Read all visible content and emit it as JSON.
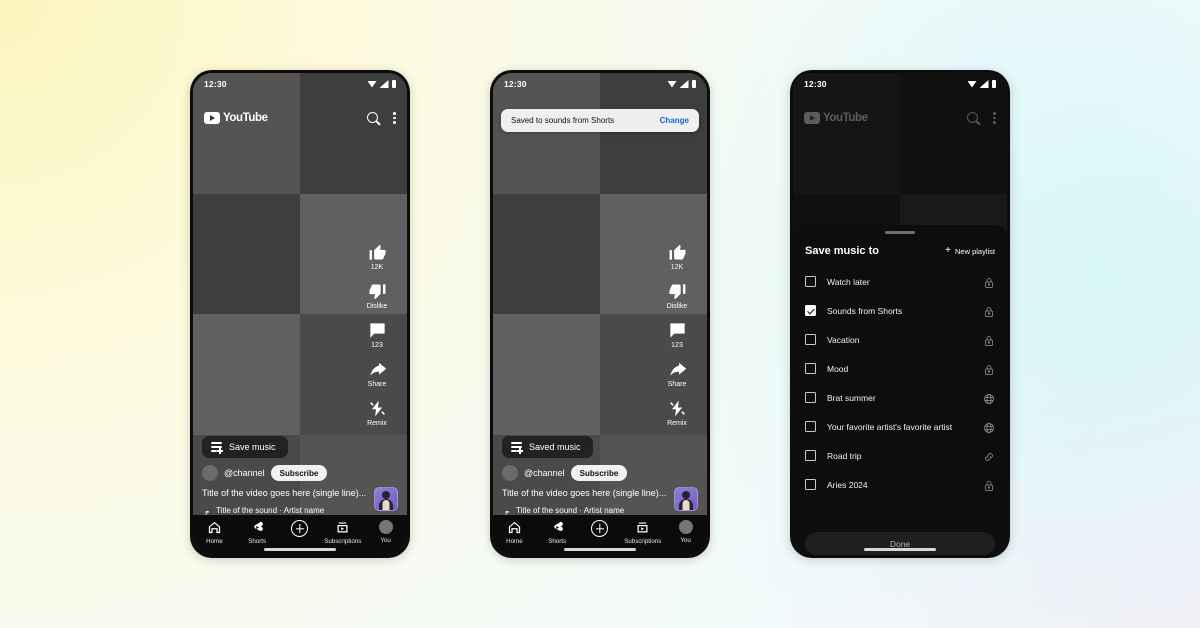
{
  "background": {
    "corner_top_left": "#fbf6bd",
    "corner_top_right": "#f1fbfb",
    "corner_bottom_right": "#fdf8fb",
    "accent_cyan": "#d6f5f8"
  },
  "status_bar": {
    "time": "12:30",
    "icons": [
      "wifi-icon",
      "signal-icon",
      "battery-icon"
    ]
  },
  "app_bar": {
    "logo_text": "YouTube",
    "search": "search-icon",
    "menu": "kebab-menu-icon"
  },
  "action_rail": [
    {
      "icon": "thumbs-up-icon",
      "label": "12K"
    },
    {
      "icon": "thumbs-down-icon",
      "label": "Dislike"
    },
    {
      "icon": "comment-icon",
      "label": "123"
    },
    {
      "icon": "share-arrow-icon",
      "label": "Share"
    },
    {
      "icon": "remix-icon",
      "label": "Remix"
    }
  ],
  "overlay": {
    "save_button_default": "Save music",
    "save_button_saved": "Saved music",
    "channel_name": "@channel",
    "subscribe_label": "Subscribe",
    "video_title": "Title of the video goes here (single line)...",
    "sound_text": "Title of the sound · Artist name"
  },
  "nav_bar": [
    {
      "icon": "home-icon",
      "label": "Home"
    },
    {
      "icon": "shorts-icon",
      "label": "Shorts"
    },
    {
      "icon": "create-plus-icon",
      "label": ""
    },
    {
      "icon": "subscriptions-icon",
      "label": "Subscriptions"
    },
    {
      "icon": "account-avatar-icon",
      "label": "You"
    }
  ],
  "toast": {
    "message": "Saved to sounds from Shorts",
    "action_label": "Change",
    "action_color": "#1464d6"
  },
  "sheet": {
    "title": "Save music to",
    "new_playlist_label": "New playlist",
    "new_playlist_icon": "plus-icon",
    "done_label": "Done",
    "playlists": [
      {
        "name": "Watch later",
        "checked": false,
        "privacy_icon": "lock-icon"
      },
      {
        "name": "Sounds from Shorts",
        "checked": true,
        "privacy_icon": "lock-icon"
      },
      {
        "name": "Vacation",
        "checked": false,
        "privacy_icon": "lock-icon"
      },
      {
        "name": "Mood",
        "checked": false,
        "privacy_icon": "lock-icon"
      },
      {
        "name": "Brat summer",
        "checked": false,
        "privacy_icon": "globe-icon"
      },
      {
        "name": "Your favorite artist's favorite artist",
        "checked": false,
        "privacy_icon": "globe-icon"
      },
      {
        "name": "Road trip",
        "checked": false,
        "privacy_icon": "link-icon"
      },
      {
        "name": "Aries 2024",
        "checked": false,
        "privacy_icon": "lock-icon"
      }
    ]
  }
}
